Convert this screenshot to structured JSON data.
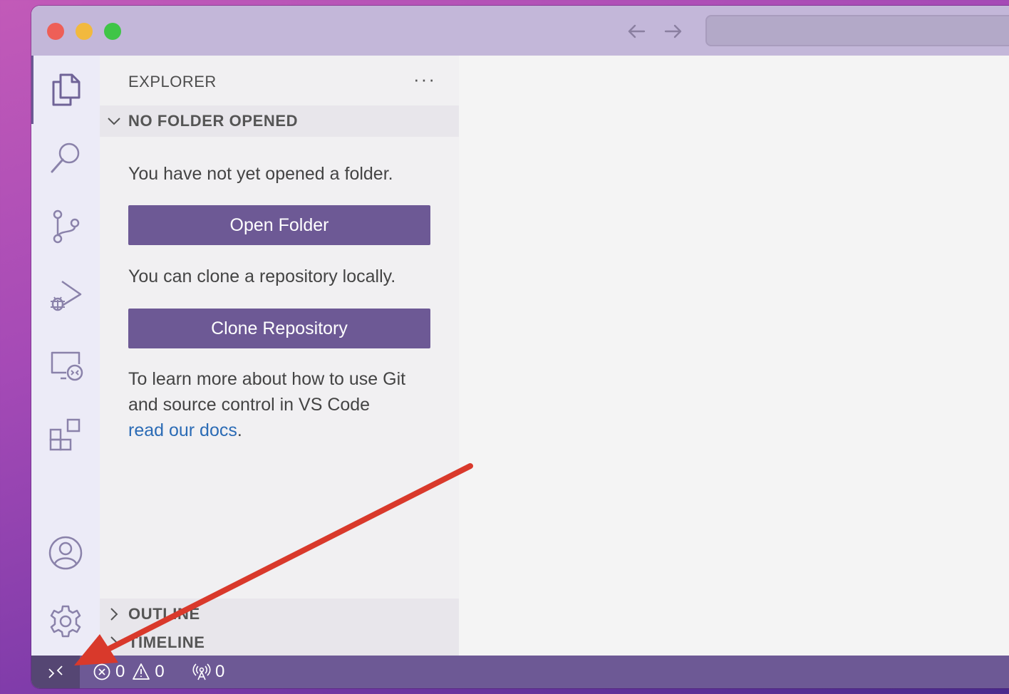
{
  "window": {
    "traffic_lights": [
      "close",
      "minimize",
      "zoom"
    ],
    "nav": {
      "back_icon": "arrow-left-icon",
      "forward_icon": "arrow-right-icon"
    }
  },
  "activity_bar": {
    "items": [
      {
        "icon": "explorer-icon",
        "active": true
      },
      {
        "icon": "search-icon"
      },
      {
        "icon": "source-control-icon"
      },
      {
        "icon": "run-debug-icon"
      },
      {
        "icon": "remote-explorer-icon"
      },
      {
        "icon": "extensions-icon"
      }
    ],
    "bottom_items": [
      {
        "icon": "account-icon"
      },
      {
        "icon": "gear-icon"
      }
    ]
  },
  "sidebar": {
    "title": "EXPLORER",
    "more_label": "···",
    "section": {
      "label": "NO FOLDER OPENED",
      "message1": "You have not yet opened a folder.",
      "open_folder_label": "Open Folder",
      "message2": "You can clone a repository locally.",
      "clone_label": "Clone Repository",
      "message3": "To learn more about how to use Git and source control in VS Code",
      "docs_link": "read our docs",
      "period": "."
    },
    "collapsed_sections": [
      "OUTLINE",
      "TIMELINE"
    ]
  },
  "status_bar": {
    "errors": "0",
    "warnings": "0",
    "ports": "0",
    "background": "#6d5995",
    "remote_background": "#554673"
  },
  "annotation": {
    "color": "#d9392b"
  }
}
